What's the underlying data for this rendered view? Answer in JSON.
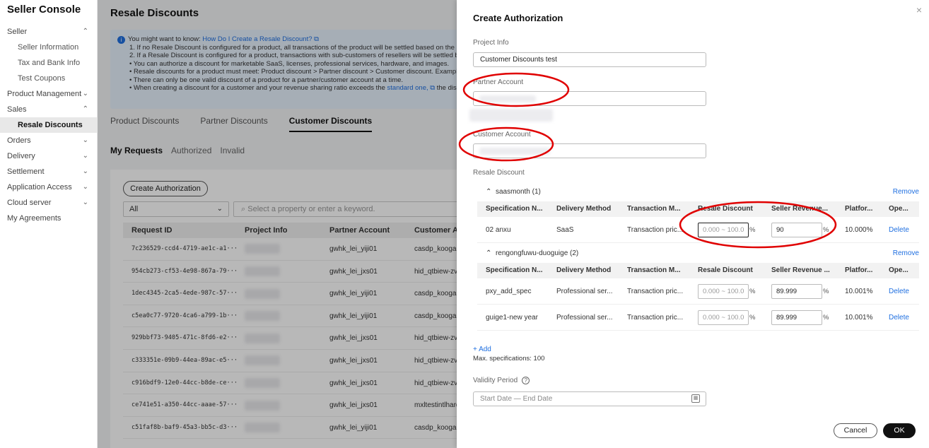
{
  "sidebar": {
    "brand": "Seller Console",
    "items": [
      {
        "label": "Seller",
        "type": "group",
        "chev": "⌃"
      },
      {
        "label": "Seller Information",
        "type": "sub"
      },
      {
        "label": "Tax and Bank Info",
        "type": "sub"
      },
      {
        "label": "Test Coupons",
        "type": "sub"
      },
      {
        "label": "Product Management",
        "type": "group",
        "chev": "⌄"
      },
      {
        "label": "Sales",
        "type": "group",
        "chev": "⌃"
      },
      {
        "label": "Resale Discounts",
        "type": "sub",
        "active": true
      },
      {
        "label": "Orders",
        "type": "group",
        "chev": "⌄"
      },
      {
        "label": "Delivery",
        "type": "group",
        "chev": "⌄"
      },
      {
        "label": "Settlement",
        "type": "group",
        "chev": "⌄"
      },
      {
        "label": "Application Access",
        "type": "group",
        "chev": "⌄"
      },
      {
        "label": "Cloud server",
        "type": "group",
        "chev": "⌄"
      },
      {
        "label": "My Agreements",
        "type": "group",
        "chev": ""
      }
    ]
  },
  "main": {
    "title": "Resale Discounts",
    "notice": {
      "intro": "You might want to know: ",
      "link": "How Do I Create a Resale Discount?",
      "lines": [
        "1. If no Resale Discount is configured for a product, all transactions of the product will be settled based on the actua",
        "2. If a Resale Discount is configured for a product, transactions with sub-customers of resellers will be settled base",
        "• You can authorize a discount for marketable SaaS, licenses, professional services, hardware, and images.",
        "• Resale discounts for a product must meet: Product discount > Partner discount > Customer discount. Example: P",
        "• There can only be one valid discount of a product for a partner/customer account at a time."
      ],
      "last_prefix": "• When creating a discount for a customer and your revenue sharing ratio exceeds the ",
      "last_link": "standard one,",
      "last_suffix": " the disc"
    },
    "tabs": [
      "Product Discounts",
      "Partner Discounts",
      "Customer Discounts"
    ],
    "subtabs": [
      "My Requests",
      "Authorized",
      "Invalid"
    ],
    "create_button": "Create Authorization",
    "filter_value": "All",
    "search_placeholder": "Select a property or enter a keyword.",
    "table": {
      "headers": [
        "Request ID",
        "Project Info",
        "Partner Account",
        "Customer Ac"
      ],
      "rows": [
        {
          "id": "7c236529-ccd4-4719-ae1c-a1···",
          "partner": "gwhk_lei_yiji01",
          "customer": "casdp_koogal"
        },
        {
          "id": "954cb273-cf53-4e98-867a-79···",
          "partner": "gwhk_lei_jxs01",
          "customer": "hid_qtbiew-zv"
        },
        {
          "id": "1dec4345-2ca5-4ede-987c-57···",
          "partner": "gwhk_lei_yiji01",
          "customer": "casdp_koogal"
        },
        {
          "id": "c5ea0c77-9720-4ca6-a799-1b···",
          "partner": "gwhk_lei_yiji01",
          "customer": "casdp_koogal"
        },
        {
          "id": "929bbf73-9405-471c-8fd6-e2···",
          "partner": "gwhk_lei_jxs01",
          "customer": "hid_qtbiew-zv"
        },
        {
          "id": "c333351e-09b9-44ea-89ac-e5···",
          "partner": "gwhk_lei_jxs01",
          "customer": "hid_qtbiew-zv"
        },
        {
          "id": "c916bdf9-12e0-44cc-b8de-ce···",
          "partner": "gwhk_lei_jxs01",
          "customer": "hid_qtbiew-zv"
        },
        {
          "id": "ce741e51-a350-44cc-aaae-57···",
          "partner": "gwhk_lei_jxs01",
          "customer": "mxltestintlhard"
        },
        {
          "id": "c51faf8b-baf9-45a3-bb5c-d3···",
          "partner": "gwhk_lei_yiji01",
          "customer": "casdp_koogal"
        }
      ]
    }
  },
  "drawer": {
    "title": "Create Authorization",
    "close": "×",
    "project_info_label": "Project Info",
    "project_info_value": "Customer Discounts test",
    "partner_account_label": "Partner Account",
    "customer_account_label": "Customer Account",
    "resale_discount_label": "Resale Discount",
    "columns": [
      "Specification N...",
      "Delivery Method",
      "Transaction M...",
      "Resale Discount",
      "Seller Revenue ...",
      "Platfor...",
      "Ope..."
    ],
    "groups": [
      {
        "name": "saasmonth (1)",
        "remove": "Remove",
        "columns": [
          "Specification N...",
          "Delivery Method",
          "Transaction M...",
          "Resale Discount",
          "Seller Revenue...",
          "Platfor...",
          "Ope..."
        ],
        "rows": [
          {
            "spec": "02 anxu",
            "delivery": "SaaS",
            "transaction": "Transaction pric...",
            "discount_placeholder": "0.000 ~ 100.0",
            "revenue": "90",
            "platform": "10.000%",
            "op": "Delete"
          }
        ]
      },
      {
        "name": "rengongfuwu-duoguige (2)",
        "remove": "Remove",
        "columns": [
          "Specification N...",
          "Delivery Method",
          "Transaction M...",
          "Resale Discount",
          "Seller Revenue ...",
          "Platfor...",
          "Ope..."
        ],
        "rows": [
          {
            "spec": "pxy_add_spec",
            "delivery": "Professional ser...",
            "transaction": "Transaction pric...",
            "discount_placeholder": "0.000 ~ 100.0",
            "revenue": "89.999",
            "platform": "10.001%",
            "op": "Delete"
          },
          {
            "spec": "guige1-new year",
            "delivery": "Professional ser...",
            "transaction": "Transaction pric...",
            "discount_placeholder": "0.000 ~ 100.0",
            "revenue": "89.999",
            "platform": "10.001%",
            "op": "Delete"
          }
        ]
      }
    ],
    "percent": "%",
    "add_label": "+ Add",
    "max_spec": "Max. specifications: 100",
    "validity_label": "Validity Period",
    "help": "?",
    "date_placeholder": "Start Date — End Date",
    "cancel": "Cancel",
    "ok": "OK"
  },
  "colors": {
    "annotation": "#e00000",
    "link": "#1f6fe0",
    "primary": "#111111"
  }
}
